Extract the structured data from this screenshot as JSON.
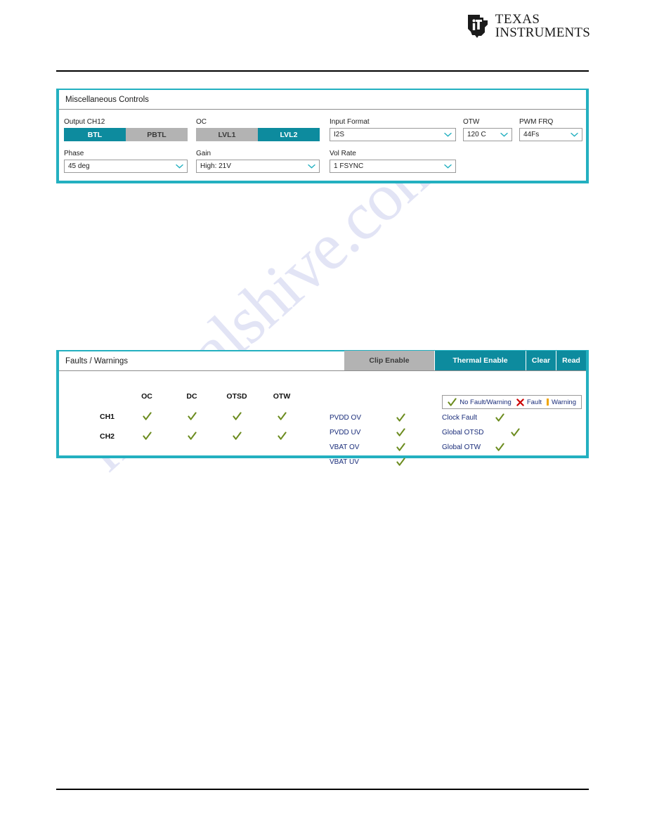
{
  "brand": {
    "logo_line1": "TEXAS",
    "logo_line2": "INSTRUMENTS",
    "accent_teal": "#0d8b9e",
    "panel_border": "#23b0c0",
    "check_green": "#6c8c1f",
    "fault_red": "#cc0000",
    "warning_orange": "#f0a500",
    "label_blue": "#1a2d7a",
    "inactive_grey": "#b3b3b3"
  },
  "watermark": {
    "text": "manualshive.com"
  },
  "misc_controls": {
    "title": "Miscellaneous Controls",
    "output_ch12": {
      "label": "Output CH12",
      "options": [
        "BTL",
        "PBTL"
      ],
      "selected": "BTL"
    },
    "oc": {
      "label": "OC",
      "options": [
        "LVL1",
        "LVL2"
      ],
      "selected": "LVL2"
    },
    "input_format": {
      "label": "Input Format",
      "value": "I2S"
    },
    "otw": {
      "label": "OTW",
      "value": "120 C"
    },
    "pwm_frq": {
      "label": "PWM FRQ",
      "value": "44Fs"
    },
    "phase": {
      "label": "Phase",
      "value": "45 deg"
    },
    "gain": {
      "label": "Gain",
      "value": "High: 21V"
    },
    "vol_rate": {
      "label": "Vol Rate",
      "value": "1 FSYNC"
    }
  },
  "faults": {
    "title": "Faults / Warnings",
    "buttons": {
      "clip_enable": "Clip Enable",
      "thermal_enable": "Thermal Enable",
      "clear": "Clear",
      "read": "Read"
    },
    "clip_enable_active": false,
    "thermal_enable_active": true,
    "legend": {
      "no_fault": "No Fault/Warning",
      "fault": "Fault",
      "warning": "Warning"
    },
    "matrix": {
      "columns": [
        "OC",
        "DC",
        "OTSD",
        "OTW"
      ],
      "rows": [
        {
          "name": "CH1",
          "states": [
            "ok",
            "ok",
            "ok",
            "ok"
          ]
        },
        {
          "name": "CH2",
          "states": [
            "ok",
            "ok",
            "ok",
            "ok"
          ]
        }
      ]
    },
    "supplies": [
      {
        "label": "PVDD OV",
        "state": "ok"
      },
      {
        "label": "PVDD UV",
        "state": "ok"
      },
      {
        "label": "VBAT OV",
        "state": "ok"
      },
      {
        "label": "VBAT UV",
        "state": "ok"
      }
    ],
    "globals": [
      {
        "label": "Clock Fault",
        "state": "ok"
      },
      {
        "label": "Global OTSD",
        "state": "ok"
      },
      {
        "label": "Global OTW",
        "state": "ok"
      }
    ]
  }
}
